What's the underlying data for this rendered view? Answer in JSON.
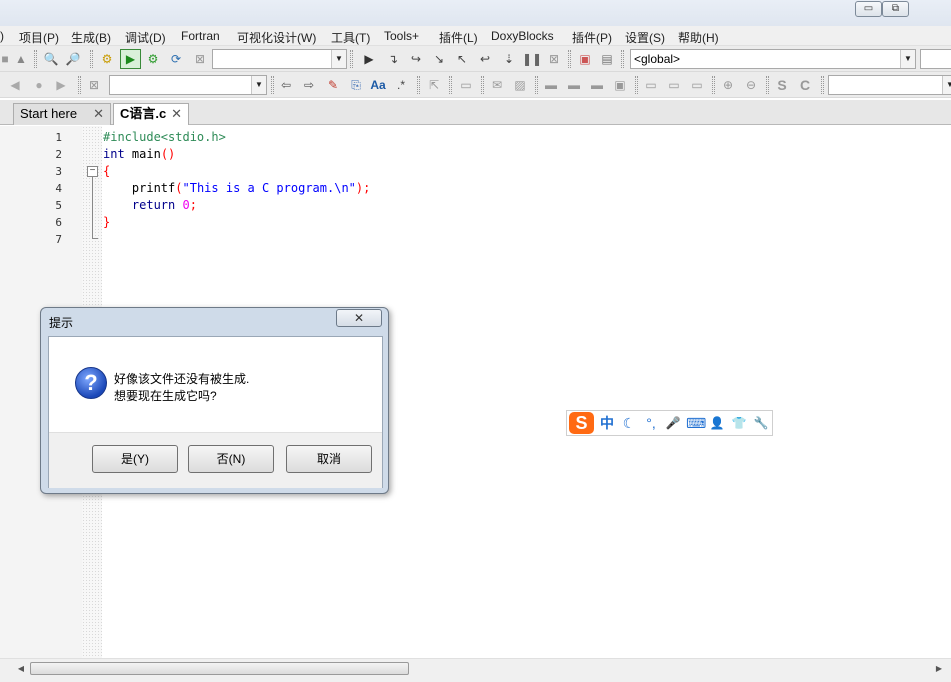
{
  "window": {
    "minimize_glyph": "▭",
    "restore_glyph": "⧉"
  },
  "menubar": {
    "items": [
      ")",
      "项目(P)",
      "生成(B)",
      "调试(D)",
      "Fortran",
      "可视化设计(W)",
      "工具(T)",
      "Tools+",
      "插件(L)",
      "DoxyBlocks",
      "插件(P)",
      "设置(S)",
      "帮助(H)"
    ]
  },
  "toolbar": {
    "scope_combo": "<global>",
    "build_target_combo": "",
    "search_combo": "",
    "icons": [
      "stop-icon",
      "new-file-icon",
      "find-icon",
      "replace-icon",
      "build-icon",
      "run-icon",
      "build-run-icon",
      "rebuild-icon",
      "abort-icon",
      "debug-icon",
      "step-icon",
      "jump-icon",
      "breakpoint-icon",
      "bookmark-prev-icon",
      "bookmark-next-icon",
      "highlight-icon",
      "match-case-icon",
      "regex-icon",
      "zoom-in-icon",
      "zoom-out-icon",
      "s-icon",
      "c-icon"
    ],
    "glyph_s": "S",
    "glyph_c": "C",
    "glyph_aa": "Aa"
  },
  "tabs": [
    {
      "label": "Start here",
      "close": "✕"
    },
    {
      "label": "C语言.c",
      "close": "✕"
    }
  ],
  "editor": {
    "line_numbers": [
      "1",
      "2",
      "3",
      "4",
      "5",
      "6",
      "7"
    ],
    "lines": [
      {
        "pre": "#include<stdio.h>"
      },
      {
        "kw": "int",
        "plain": " main",
        "op": "()"
      },
      {
        "op": "{"
      },
      {
        "indent": "    ",
        "plain": "printf",
        "op1": "(",
        "str": "\"This is a C program.\\n\"",
        "op2": ");"
      },
      {
        "indent": "    ",
        "kw": "return",
        "sp": " ",
        "num": "0",
        "op": ";"
      },
      {
        "op": "}"
      },
      {}
    ],
    "fold_glyph": "−"
  },
  "dialog": {
    "title": "提示",
    "close": "✕",
    "icon_glyph": "?",
    "message_line1": "好像该文件还没有被生成.",
    "message_line2": "想要现在生成它吗?",
    "buttons": {
      "yes": "是(Y)",
      "no": "否(N)",
      "cancel": "取消"
    }
  },
  "ime": {
    "logo": "S",
    "mode": "中",
    "items": [
      "☾",
      "°,",
      "🎤",
      "⌨",
      "👤",
      "👕",
      "🔧"
    ]
  },
  "scrollbar": {
    "left": "◀",
    "right": "▶"
  },
  "colors": {
    "preprocessor": "#2e8b57",
    "keyword": "#00008b",
    "string": "#0000ff",
    "number": "#f000f0",
    "operator": "#ff0000",
    "ime_orange": "#ff6a13"
  }
}
